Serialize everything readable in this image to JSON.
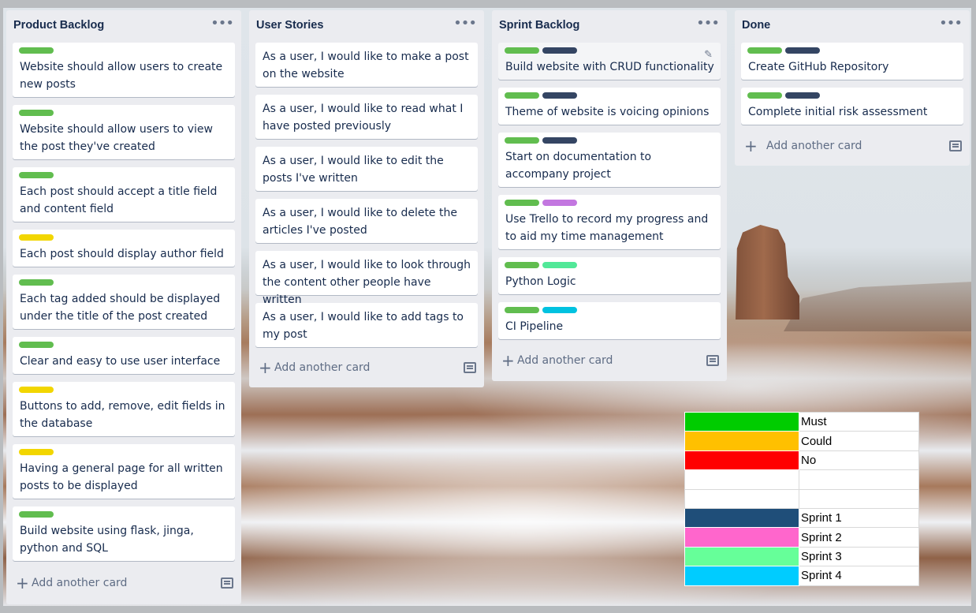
{
  "colors": {
    "green_label": "#61bd4f",
    "yellow_label": "#f2d600",
    "navy_label": "#344563",
    "purple_label": "#c377e0",
    "lime_label": "#51e898",
    "sky_label": "#00c2e0"
  },
  "lists": [
    {
      "title": "Product Backlog",
      "menu_icon": "ellipsis-icon",
      "add_card": "Add another card",
      "cards": [
        {
          "labels": [
            "green"
          ],
          "text": "Website should allow users to create new posts"
        },
        {
          "labels": [
            "green"
          ],
          "text": "Website should allow users to view the post they've created"
        },
        {
          "labels": [
            "green"
          ],
          "text": "Each post should accept a title field and content field"
        },
        {
          "labels": [
            "yellow"
          ],
          "text": "Each post should display author field"
        },
        {
          "labels": [
            "green"
          ],
          "text": "Each tag added should be displayed under the title of the post created"
        },
        {
          "labels": [
            "green"
          ],
          "text": "Clear and easy to use user interface"
        },
        {
          "labels": [
            "yellow"
          ],
          "text": "Buttons to add, remove, edit fields in the database"
        },
        {
          "labels": [
            "yellow"
          ],
          "text": "Having a general page for all written posts to be displayed"
        },
        {
          "labels": [
            "green"
          ],
          "text": "Build website using flask, jinga, python and SQL"
        }
      ]
    },
    {
      "title": "User Stories",
      "menu_icon": "ellipsis-icon",
      "add_card": "Add another card",
      "cards": [
        {
          "labels": [],
          "text": "As a user, I would like to make a post on the website"
        },
        {
          "labels": [],
          "text": "As a user, I would like to read what I have posted previously"
        },
        {
          "labels": [],
          "text": "As a user, I would like to edit the posts I've written"
        },
        {
          "labels": [],
          "text": "As a user, I would like to delete the articles I've posted"
        },
        {
          "labels": [],
          "text": "As a user, I would like to look through the content other people have written"
        },
        {
          "labels": [],
          "text": "As a user, I would like to add tags to my post"
        }
      ]
    },
    {
      "title": "Sprint Backlog",
      "menu_icon": "ellipsis-icon",
      "add_card": "Add another card",
      "cards": [
        {
          "labels": [
            "green",
            "navy"
          ],
          "text": "Build website with CRUD functionality"
        },
        {
          "labels": [
            "green",
            "navy"
          ],
          "text": "Theme of website is voicing opinions"
        },
        {
          "labels": [
            "green",
            "navy"
          ],
          "text": "Start on documentation to accompany project"
        },
        {
          "labels": [
            "green",
            "purple"
          ],
          "text": "Use Trello to record my progress and to aid my time management"
        },
        {
          "labels": [
            "green",
            "lime"
          ],
          "text": "Python Logic"
        },
        {
          "labels": [
            "green",
            "sky"
          ],
          "text": "CI Pipeline"
        }
      ]
    },
    {
      "title": "Done",
      "menu_icon": "ellipsis-icon",
      "add_card": "Add another card",
      "cards": [
        {
          "labels": [
            "green",
            "navy"
          ],
          "text": "Create GitHub Repository"
        },
        {
          "labels": [
            "green",
            "navy"
          ],
          "text": "Complete initial risk assessment"
        }
      ]
    }
  ],
  "legend": [
    {
      "color": "#00cc00",
      "label": "Must"
    },
    {
      "color": "#ffc000",
      "label": "Could"
    },
    {
      "color": "#ff0000",
      "label": "No"
    },
    {
      "color": "#ffffff",
      "label": ""
    },
    {
      "color": "#ffffff",
      "label": ""
    },
    {
      "color": "#1f4e79",
      "label": "Sprint 1"
    },
    {
      "color": "#ff66cc",
      "label": "Sprint 2"
    },
    {
      "color": "#66ff99",
      "label": "Sprint 3"
    },
    {
      "color": "#00ccff",
      "label": "Sprint 4"
    }
  ]
}
